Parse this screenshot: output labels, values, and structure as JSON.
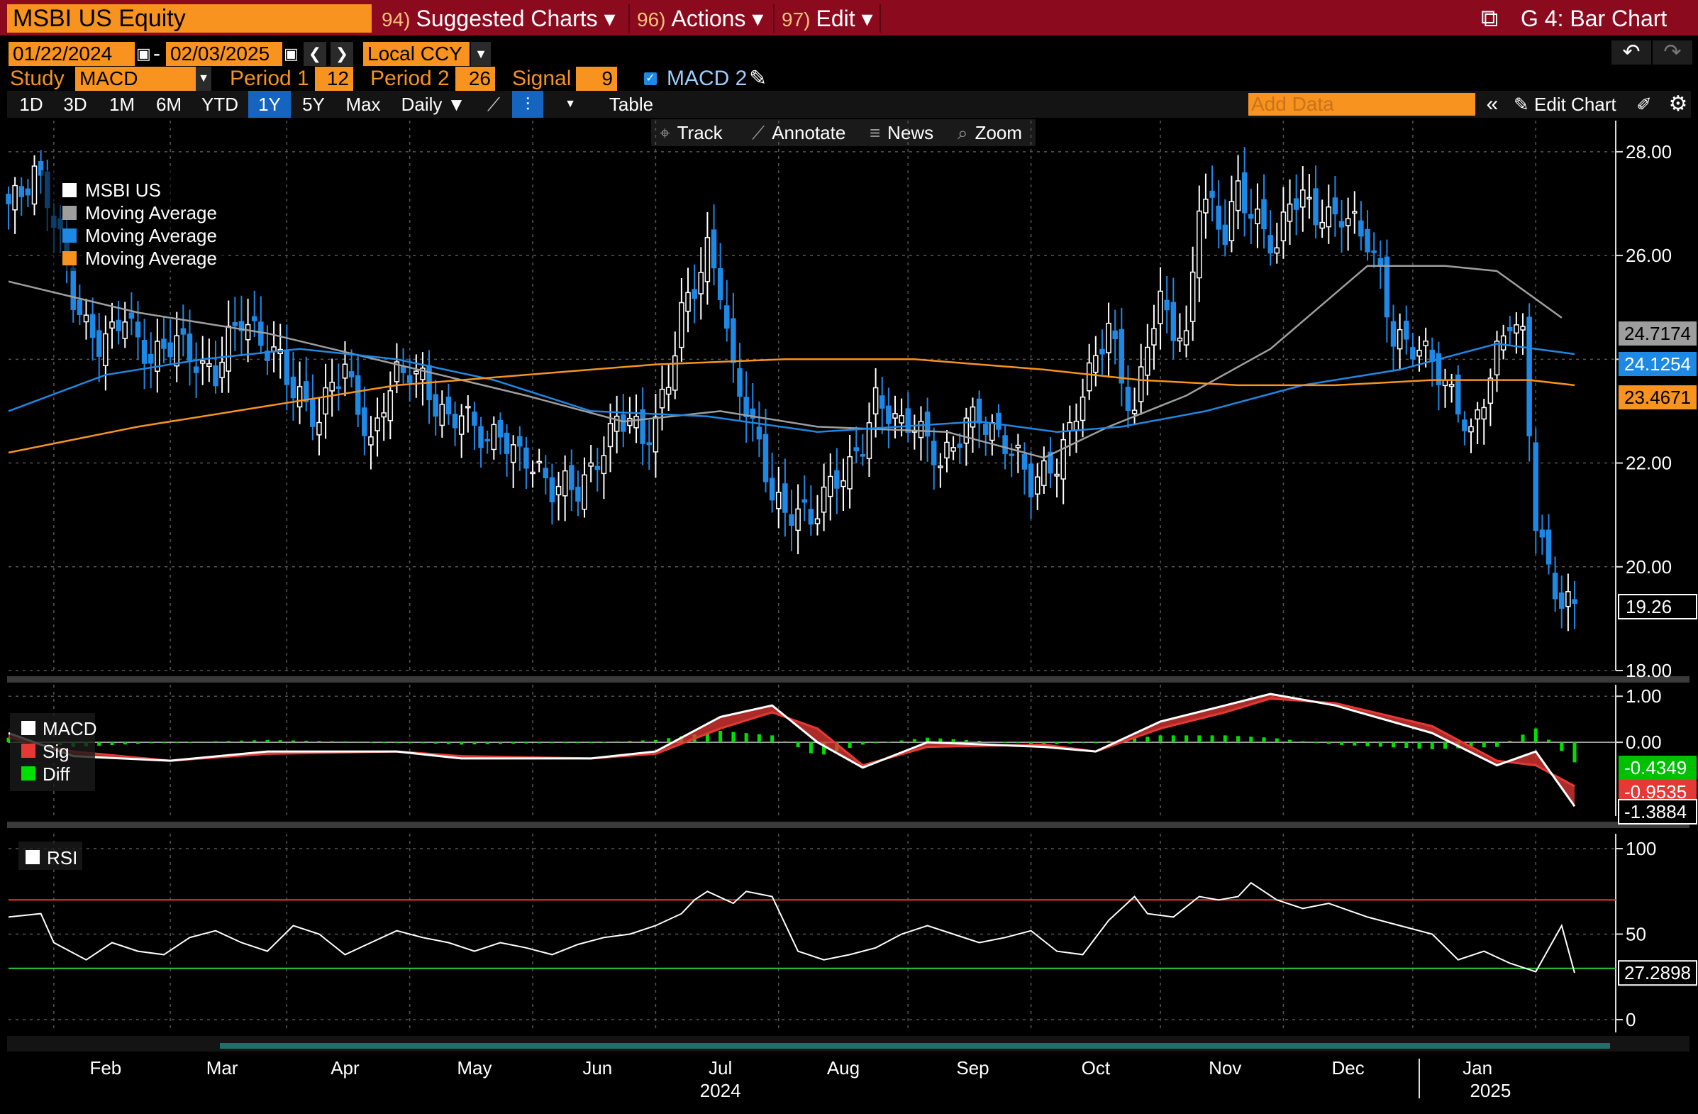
{
  "header": {
    "ticker": "MSBI US Equity",
    "menus": [
      {
        "num": "94)",
        "label": "Suggested Charts ▾"
      },
      {
        "num": "96)",
        "label": "Actions ▾"
      },
      {
        "num": "97)",
        "label": "Edit ▾"
      }
    ],
    "chart_title": "G 4: Bar Chart"
  },
  "controls": {
    "date_from": "01/22/2024",
    "date_to": "02/03/2025",
    "date_sep": "-",
    "currency": "Local CCY",
    "study_label": "Study",
    "study_value": "MACD",
    "period1_label": "Period 1",
    "period1_value": "12",
    "period2_label": "Period 2",
    "period2_value": "26",
    "signal_label": "Signal",
    "signal_value": "9",
    "macd2_label": "MACD 2",
    "ranges": [
      "1D",
      "3D",
      "1M",
      "6M",
      "YTD",
      "1Y",
      "5Y",
      "Max"
    ],
    "active_range": "1Y",
    "frequency": "Daily ▼",
    "table_label": "Table",
    "add_data_placeholder": "Add Data",
    "edit_chart_label": "Edit Chart",
    "tools": [
      "Track",
      "Annotate",
      "News",
      "Zoom"
    ]
  },
  "colors": {
    "price_up": "#ffffff",
    "price_down": "#1e88e5",
    "ma_fast": "#9e9e9e",
    "ma_mid": "#1e88e5",
    "ma_slow": "#f7931e",
    "macd": "#ffffff",
    "sig": "#e53935",
    "diff": "#00e000",
    "overbought": "#e53935",
    "oversold": "#2ecc40"
  },
  "chart_data": [
    {
      "type": "bar",
      "legend": [
        "MSBI US",
        "Moving Average",
        "Moving Average",
        "Moving Average"
      ],
      "ylim": [
        18,
        28.6
      ],
      "yticks": [
        "28.00",
        "26.00",
        "24.00",
        "22.00",
        "20.00",
        "18.00"
      ],
      "last_values": {
        "ma_fast": "24.7174",
        "ma_mid": "24.1254",
        "ma_slow": "23.4671",
        "price": "19.26"
      },
      "x_months": [
        "Feb",
        "Mar",
        "Apr",
        "May",
        "Jun",
        "Jul",
        "Aug",
        "Sep",
        "Oct",
        "Nov",
        "Dec",
        "Jan"
      ],
      "x_years": [
        "2024",
        "2025"
      ],
      "price_points": [
        [
          0,
          27.0
        ],
        [
          2,
          27.2
        ],
        [
          4,
          27.6
        ],
        [
          6,
          27.1
        ],
        [
          8,
          26.3
        ],
        [
          10,
          25.2
        ],
        [
          12,
          24.6
        ],
        [
          14,
          24.3
        ],
        [
          16,
          24.5
        ],
        [
          18,
          24.9
        ],
        [
          20,
          24.3
        ],
        [
          22,
          24.0
        ],
        [
          24,
          24.2
        ],
        [
          26,
          24.4
        ],
        [
          28,
          24.1
        ],
        [
          30,
          23.8
        ],
        [
          32,
          23.7
        ],
        [
          34,
          24.4
        ],
        [
          36,
          24.8
        ],
        [
          38,
          24.5
        ],
        [
          40,
          24.2
        ],
        [
          42,
          24.0
        ],
        [
          44,
          23.4
        ],
        [
          46,
          23.1
        ],
        [
          48,
          22.8
        ],
        [
          50,
          23.6
        ],
        [
          52,
          23.8
        ],
        [
          54,
          23.1
        ],
        [
          56,
          22.3
        ],
        [
          58,
          23.2
        ],
        [
          60,
          23.7
        ],
        [
          62,
          23.8
        ],
        [
          64,
          23.6
        ],
        [
          66,
          23.1
        ],
        [
          68,
          22.8
        ],
        [
          70,
          23.0
        ],
        [
          72,
          22.7
        ],
        [
          74,
          22.4
        ],
        [
          76,
          22.6
        ],
        [
          78,
          22.2
        ],
        [
          80,
          22.1
        ],
        [
          82,
          21.8
        ],
        [
          84,
          21.5
        ],
        [
          86,
          21.6
        ],
        [
          88,
          21.5
        ],
        [
          90,
          21.8
        ],
        [
          92,
          22.3
        ],
        [
          94,
          22.8
        ],
        [
          96,
          22.9
        ],
        [
          98,
          22.4
        ],
        [
          100,
          22.8
        ],
        [
          102,
          23.6
        ],
        [
          104,
          24.9
        ],
        [
          106,
          25.4
        ],
        [
          108,
          26.1
        ],
        [
          110,
          25.4
        ],
        [
          112,
          23.7
        ],
        [
          114,
          23.1
        ],
        [
          116,
          22.3
        ],
        [
          118,
          21.4
        ],
        [
          120,
          21.0
        ],
        [
          122,
          21.1
        ],
        [
          124,
          20.9
        ],
        [
          126,
          21.4
        ],
        [
          128,
          21.7
        ],
        [
          130,
          21.9
        ],
        [
          132,
          22.4
        ],
        [
          134,
          23.2
        ],
        [
          136,
          23.0
        ],
        [
          138,
          22.7
        ],
        [
          140,
          22.8
        ],
        [
          142,
          22.4
        ],
        [
          144,
          22.0
        ],
        [
          146,
          22.3
        ],
        [
          148,
          22.8
        ],
        [
          150,
          22.9
        ],
        [
          152,
          22.6
        ],
        [
          154,
          22.4
        ],
        [
          156,
          22.1
        ],
        [
          158,
          21.6
        ],
        [
          160,
          21.8
        ],
        [
          162,
          22.0
        ],
        [
          164,
          22.6
        ],
        [
          166,
          23.4
        ],
        [
          168,
          24.0
        ],
        [
          170,
          24.7
        ],
        [
          172,
          23.6
        ],
        [
          174,
          22.9
        ],
        [
          176,
          24.4
        ],
        [
          178,
          25.1
        ],
        [
          180,
          24.6
        ],
        [
          182,
          24.3
        ],
        [
          184,
          27.1
        ],
        [
          186,
          26.9
        ],
        [
          188,
          26.4
        ],
        [
          190,
          27.3
        ],
        [
          192,
          26.8
        ],
        [
          194,
          26.5
        ],
        [
          196,
          26.1
        ],
        [
          198,
          27.1
        ],
        [
          200,
          27.1
        ],
        [
          202,
          26.8
        ],
        [
          204,
          26.7
        ],
        [
          206,
          26.8
        ],
        [
          208,
          26.6
        ],
        [
          210,
          26.3
        ],
        [
          212,
          25.6
        ],
        [
          214,
          24.4
        ],
        [
          216,
          24.3
        ],
        [
          218,
          24.2
        ],
        [
          220,
          24.0
        ],
        [
          222,
          23.5
        ],
        [
          224,
          23.1
        ],
        [
          226,
          22.5
        ],
        [
          228,
          23.3
        ],
        [
          230,
          24.1
        ],
        [
          232,
          24.8
        ],
        [
          234,
          24.4
        ],
        [
          236,
          20.9
        ],
        [
          238,
          19.9
        ],
        [
          240,
          19.3
        ],
        [
          242,
          19.26
        ]
      ],
      "ma_fast_points": [
        [
          0,
          25.5
        ],
        [
          20,
          24.9
        ],
        [
          40,
          24.5
        ],
        [
          60,
          23.9
        ],
        [
          80,
          23.3
        ],
        [
          95,
          22.8
        ],
        [
          110,
          23.0
        ],
        [
          125,
          22.7
        ],
        [
          145,
          22.6
        ],
        [
          160,
          22.1
        ],
        [
          170,
          22.7
        ],
        [
          182,
          23.3
        ],
        [
          195,
          24.2
        ],
        [
          210,
          25.8
        ],
        [
          222,
          25.8
        ],
        [
          230,
          25.7
        ],
        [
          240,
          24.8
        ]
      ],
      "ma_mid_points": [
        [
          0,
          23.0
        ],
        [
          15,
          23.7
        ],
        [
          30,
          24.0
        ],
        [
          45,
          24.2
        ],
        [
          60,
          24.0
        ],
        [
          75,
          23.6
        ],
        [
          90,
          23.0
        ],
        [
          108,
          22.9
        ],
        [
          125,
          22.6
        ],
        [
          150,
          22.8
        ],
        [
          162,
          22.6
        ],
        [
          172,
          22.7
        ],
        [
          185,
          23.0
        ],
        [
          200,
          23.5
        ],
        [
          215,
          23.8
        ],
        [
          230,
          24.3
        ],
        [
          242,
          24.1
        ]
      ],
      "ma_slow_points": [
        [
          0,
          22.2
        ],
        [
          20,
          22.7
        ],
        [
          40,
          23.1
        ],
        [
          60,
          23.5
        ],
        [
          80,
          23.7
        ],
        [
          100,
          23.9
        ],
        [
          120,
          24.0
        ],
        [
          140,
          24.0
        ],
        [
          160,
          23.8
        ],
        [
          175,
          23.6
        ],
        [
          190,
          23.5
        ],
        [
          205,
          23.5
        ],
        [
          220,
          23.6
        ],
        [
          235,
          23.6
        ],
        [
          242,
          23.5
        ]
      ]
    },
    {
      "type": "line",
      "legend": [
        "MACD",
        "Sig",
        "Diff"
      ],
      "ylim": [
        -1.6,
        1.25
      ],
      "yticks": [
        "1.00",
        "0.00"
      ],
      "last_values": {
        "diff": "-0.4349",
        "sig": "-0.9535",
        "macd": "-1.3884"
      },
      "macd_points": [
        [
          0,
          0.2
        ],
        [
          10,
          -0.3
        ],
        [
          25,
          -0.4
        ],
        [
          40,
          -0.2
        ],
        [
          60,
          -0.2
        ],
        [
          70,
          -0.35
        ],
        [
          90,
          -0.35
        ],
        [
          100,
          -0.2
        ],
        [
          110,
          0.55
        ],
        [
          118,
          0.8
        ],
        [
          125,
          0.0
        ],
        [
          132,
          -0.55
        ],
        [
          142,
          0.0
        ],
        [
          160,
          -0.1
        ],
        [
          168,
          -0.2
        ],
        [
          178,
          0.45
        ],
        [
          188,
          0.8
        ],
        [
          195,
          1.05
        ],
        [
          205,
          0.8
        ],
        [
          220,
          0.2
        ],
        [
          230,
          -0.5
        ],
        [
          236,
          -0.2
        ],
        [
          242,
          -1.3884
        ]
      ],
      "sig_points": [
        [
          0,
          0.1
        ],
        [
          10,
          -0.2
        ],
        [
          25,
          -0.4
        ],
        [
          40,
          -0.25
        ],
        [
          60,
          -0.2
        ],
        [
          70,
          -0.3
        ],
        [
          90,
          -0.35
        ],
        [
          100,
          -0.25
        ],
        [
          110,
          0.3
        ],
        [
          118,
          0.65
        ],
        [
          125,
          0.3
        ],
        [
          132,
          -0.5
        ],
        [
          142,
          -0.1
        ],
        [
          160,
          -0.05
        ],
        [
          168,
          -0.2
        ],
        [
          178,
          0.3
        ],
        [
          188,
          0.65
        ],
        [
          195,
          0.95
        ],
        [
          205,
          0.85
        ],
        [
          220,
          0.35
        ],
        [
          230,
          -0.4
        ],
        [
          236,
          -0.5
        ],
        [
          242,
          -0.9535
        ]
      ],
      "diff_last": -0.4349
    },
    {
      "type": "line",
      "legend": [
        "RSI"
      ],
      "ylim": [
        0,
        100
      ],
      "yticks": [
        "100",
        "50",
        "0"
      ],
      "last_values": {
        "rsi": "27.2898"
      },
      "levels": [
        70,
        30
      ],
      "rsi_points": [
        [
          0,
          60
        ],
        [
          5,
          62
        ],
        [
          7,
          45
        ],
        [
          12,
          35
        ],
        [
          16,
          45
        ],
        [
          20,
          40
        ],
        [
          24,
          38
        ],
        [
          28,
          48
        ],
        [
          32,
          52
        ],
        [
          36,
          45
        ],
        [
          40,
          40
        ],
        [
          44,
          55
        ],
        [
          48,
          50
        ],
        [
          52,
          38
        ],
        [
          56,
          45
        ],
        [
          60,
          52
        ],
        [
          64,
          48
        ],
        [
          68,
          45
        ],
        [
          72,
          40
        ],
        [
          76,
          45
        ],
        [
          80,
          42
        ],
        [
          84,
          38
        ],
        [
          88,
          44
        ],
        [
          92,
          48
        ],
        [
          96,
          50
        ],
        [
          100,
          55
        ],
        [
          104,
          62
        ],
        [
          106,
          70
        ],
        [
          108,
          75
        ],
        [
          112,
          68
        ],
        [
          114,
          75
        ],
        [
          118,
          72
        ],
        [
          122,
          40
        ],
        [
          126,
          35
        ],
        [
          130,
          38
        ],
        [
          134,
          42
        ],
        [
          138,
          50
        ],
        [
          142,
          55
        ],
        [
          146,
          50
        ],
        [
          150,
          45
        ],
        [
          154,
          48
        ],
        [
          158,
          52
        ],
        [
          162,
          40
        ],
        [
          166,
          38
        ],
        [
          170,
          58
        ],
        [
          174,
          72
        ],
        [
          176,
          62
        ],
        [
          180,
          60
        ],
        [
          184,
          72
        ],
        [
          187,
          70
        ],
        [
          190,
          72
        ],
        [
          192,
          80
        ],
        [
          196,
          70
        ],
        [
          200,
          65
        ],
        [
          204,
          68
        ],
        [
          210,
          60
        ],
        [
          215,
          55
        ],
        [
          220,
          50
        ],
        [
          224,
          35
        ],
        [
          228,
          40
        ],
        [
          232,
          33
        ],
        [
          236,
          28
        ],
        [
          240,
          55
        ],
        [
          242,
          27.2898
        ]
      ]
    }
  ]
}
